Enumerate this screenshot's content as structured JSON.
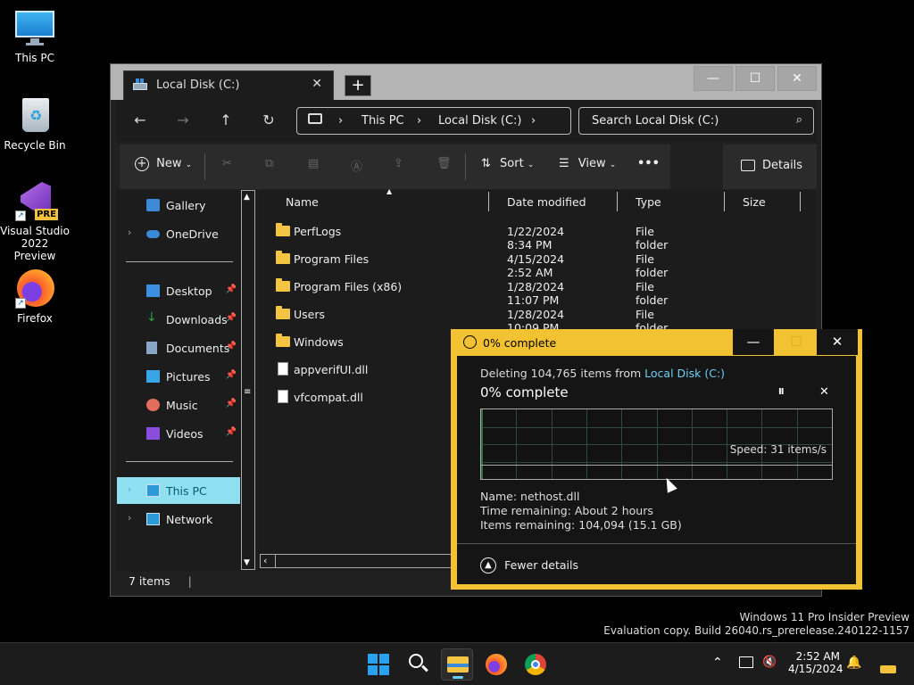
{
  "desktop": {
    "icons": [
      {
        "label": "This PC",
        "icon": "monitor-icon"
      },
      {
        "label": "Recycle Bin",
        "icon": "recycle-bin-icon"
      },
      {
        "label": "Visual Studio 2022 Preview",
        "badge": "PRE",
        "icon": "visual-studio-icon"
      },
      {
        "label": "Firefox",
        "icon": "firefox-icon"
      }
    ],
    "watermark": {
      "line1": "Windows 11 Pro Insider Preview",
      "line2": "Evaluation copy. Build 26040.rs_prerelease.240122-1157"
    }
  },
  "explorer": {
    "tab_title": "Local Disk (C:)",
    "tab_close": "✕",
    "new_tab": "+",
    "window_buttons": {
      "minimize": "—",
      "maximize": "☐",
      "close": "✕"
    },
    "breadcrumb": [
      "This PC",
      "Local Disk (C:)"
    ],
    "search_placeholder": "Search Local Disk (C:)",
    "toolbar": {
      "new_label": "New",
      "sort_label": "Sort",
      "view_label": "View",
      "more_label": "•••",
      "details_label": "Details"
    },
    "sidebar": {
      "top_items": [
        {
          "label": "Gallery",
          "icon": "gallery-icon",
          "chevron": false
        },
        {
          "label": "OneDrive",
          "icon": "onedrive-icon",
          "chevron": true
        }
      ],
      "pinned": [
        {
          "label": "Desktop",
          "icon": "desktop-icon",
          "color": "#3d8fe0"
        },
        {
          "label": "Downloads",
          "icon": "download-icon",
          "color": "#2ea043"
        },
        {
          "label": "Documents",
          "icon": "documents-icon",
          "color": "#8aa4c8"
        },
        {
          "label": "Pictures",
          "icon": "pictures-icon",
          "color": "#36a6e8"
        },
        {
          "label": "Music",
          "icon": "music-icon",
          "color": "#e36c5d"
        },
        {
          "label": "Videos",
          "icon": "videos-icon",
          "color": "#8a4de0"
        }
      ],
      "bottom_items": [
        {
          "label": "This PC",
          "icon": "this-pc-icon",
          "selected": true
        },
        {
          "label": "Network",
          "icon": "network-icon",
          "selected": false
        }
      ]
    },
    "columns": {
      "name": "Name",
      "date": "Date modified",
      "type": "Type",
      "size": "Size"
    },
    "files": [
      {
        "name": "PerfLogs",
        "date": "1/22/2024 8:34 PM",
        "type": "File folder",
        "kind": "folder"
      },
      {
        "name": "Program Files",
        "date": "4/15/2024 2:52 AM",
        "type": "File folder",
        "kind": "folder"
      },
      {
        "name": "Program Files (x86)",
        "date": "1/28/2024 11:07 PM",
        "type": "File folder",
        "kind": "folder"
      },
      {
        "name": "Users",
        "date": "1/28/2024 10:09 PM",
        "type": "File folder",
        "kind": "folder"
      },
      {
        "name": "Windows",
        "date": "",
        "type": "",
        "kind": "folder"
      },
      {
        "name": "appverifUI.dll",
        "date": "",
        "type": "",
        "kind": "dll"
      },
      {
        "name": "vfcompat.dll",
        "date": "",
        "type": "",
        "kind": "dll"
      }
    ],
    "status": "7 items"
  },
  "progress_dialog": {
    "title": "0% complete",
    "deleting_prefix": "Deleting 104,765 items from ",
    "deleting_link": "Local Disk (C:)",
    "percent_text": "0% complete",
    "speed": "Speed: 31 items/s",
    "name_line": "Name:  nethost.dll",
    "time_line": "Time remaining:  About 2 hours",
    "items_line": "Items remaining:  104,094 (15.1 GB)",
    "fewer_details": "Fewer details",
    "progress_fraction": 0.0,
    "buttons": {
      "minimize": "—",
      "maximize": "☐",
      "close": "✕",
      "pause": "II",
      "cancel": "✕"
    }
  },
  "taskbar": {
    "clock_time": "2:52 AM",
    "clock_date": "4/15/2024",
    "apps": [
      "start-icon",
      "search-icon",
      "file-explorer-icon",
      "firefox-icon",
      "chrome-icon"
    ]
  }
}
